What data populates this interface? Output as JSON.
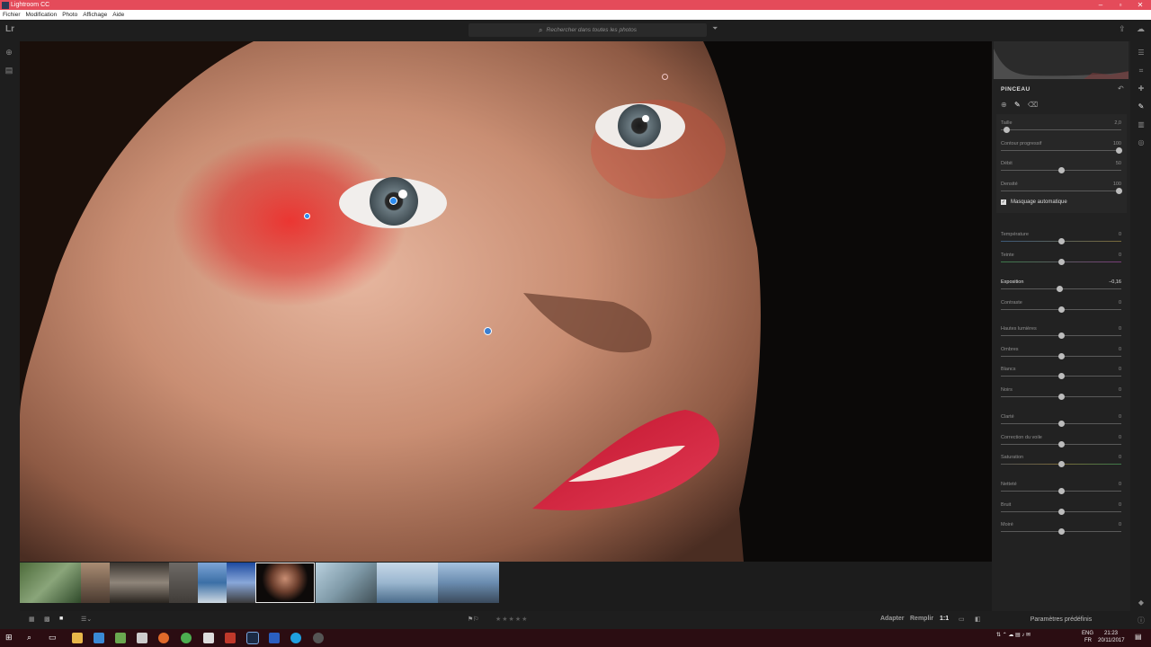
{
  "window": {
    "title": "Lightroom CC"
  },
  "menu": [
    "Fichier",
    "Modification",
    "Photo",
    "Affichage",
    "Aide"
  ],
  "topbar": {
    "logo": "Lr",
    "search_placeholder": "Rechercher dans toutes les photos"
  },
  "brush_panel": {
    "title": "PINCEAU",
    "sliders": [
      {
        "label": "Taille",
        "value": "2,0"
      },
      {
        "label": "Contour progressif",
        "value": "100"
      },
      {
        "label": "Débit",
        "value": "50"
      },
      {
        "label": "Densité",
        "value": "100"
      }
    ],
    "auto_mask_label": "Masquage automatique"
  },
  "adjustments": [
    {
      "label": "Température",
      "value": "0"
    },
    {
      "label": "Teinte",
      "value": "0"
    },
    {
      "label": "Exposition",
      "value": "−0,16"
    },
    {
      "label": "Contraste",
      "value": "0"
    },
    {
      "label": "Hautes lumières",
      "value": "0"
    },
    {
      "label": "Ombres",
      "value": "0"
    },
    {
      "label": "Blancs",
      "value": "0"
    },
    {
      "label": "Noirs",
      "value": "0"
    },
    {
      "label": "Clarté",
      "value": "0"
    },
    {
      "label": "Correction du voile",
      "value": "0"
    },
    {
      "label": "Saturation",
      "value": "0"
    },
    {
      "label": "Netteté",
      "value": "0"
    },
    {
      "label": "Bruit",
      "value": "0"
    },
    {
      "label": "Moiré",
      "value": "0"
    }
  ],
  "bottombar": {
    "fit": "Adapter",
    "fill": "Remplir",
    "ratio": "1:1",
    "stars": "★★★★★"
  },
  "presets_label": "Paramètres prédéfinis",
  "taskbar": {
    "lang": "ENG",
    "region": "FR",
    "time": "21:23",
    "date": "20/11/2017"
  },
  "colors": {
    "title_bar": "#e44b5a",
    "pin": "#2d8cf0",
    "accent_red": "#d42a3a"
  }
}
